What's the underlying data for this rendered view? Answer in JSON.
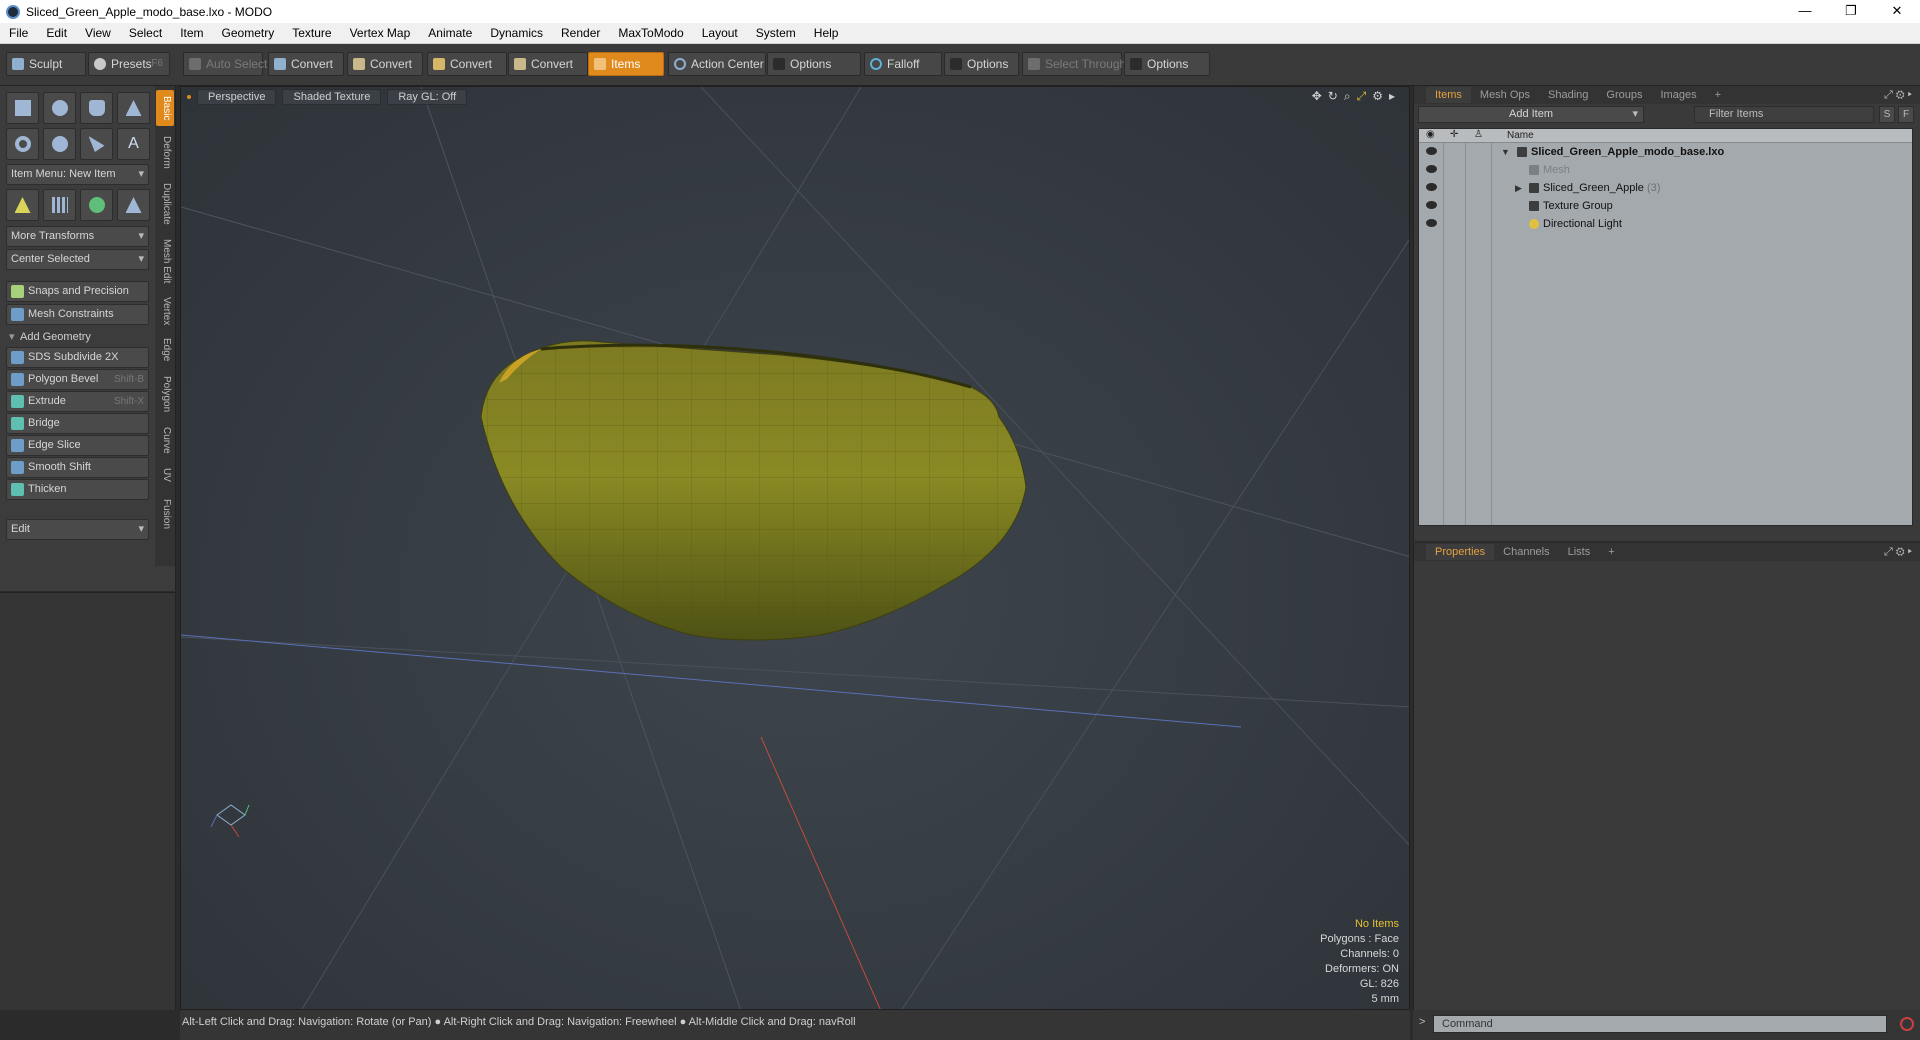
{
  "window": {
    "title": "Sliced_Green_Apple_modo_base.lxo - MODO",
    "controls": [
      "—",
      "❐",
      "✕"
    ]
  },
  "menubar": [
    "File",
    "Edit",
    "View",
    "Select",
    "Item",
    "Geometry",
    "Texture",
    "Vertex Map",
    "Animate",
    "Dynamics",
    "Render",
    "MaxToModo",
    "Layout",
    "System",
    "Help"
  ],
  "toolbar": {
    "sculpt": "Sculpt",
    "presets": "Presets",
    "presets_hotkey": "F6",
    "auto_select": "Auto Select",
    "convert1": "Convert",
    "convert2": "Convert",
    "convert3": "Convert",
    "convert4": "Convert",
    "items": "Items",
    "action_center": "Action Center",
    "options1": "Options",
    "falloff": "Falloff",
    "options2": "Options",
    "select_through": "Select Through",
    "options3": "Options"
  },
  "left_tabs": [
    "Basic",
    "Deform",
    "Duplicate",
    "Mesh Edit",
    "Vertex",
    "Edge",
    "Polygon",
    "Curve",
    "UV",
    "Fusion"
  ],
  "left_panel": {
    "item_menu": "Item Menu: New Item",
    "more_transforms": "More Transforms",
    "center_selected": "Center Selected",
    "snaps": "Snaps and Precision",
    "mesh_constraints": "Mesh Constraints",
    "add_geometry": "Add Geometry",
    "tools": [
      {
        "label": "SDS Subdivide 2X",
        "hotkey": ""
      },
      {
        "label": "Polygon Bevel",
        "hotkey": "Shift-B"
      },
      {
        "label": "Extrude",
        "hotkey": "Shift-X"
      },
      {
        "label": "Bridge",
        "hotkey": ""
      },
      {
        "label": "Edge Slice",
        "hotkey": ""
      },
      {
        "label": "Smooth Shift",
        "hotkey": ""
      },
      {
        "label": "Thicken",
        "hotkey": ""
      }
    ],
    "edit_dropdown": "Edit"
  },
  "viewport": {
    "tabs": [
      "Perspective",
      "Shaded Texture",
      "Ray GL: Off"
    ],
    "stats": {
      "items": "No Items",
      "polygons": "Polygons : Face",
      "channels": "Channels: 0",
      "deformers": "Deformers: ON",
      "gl": "GL: 826",
      "scale": "5 mm"
    },
    "status": "Alt-Left Click and Drag: Navigation: Rotate (or Pan) ● Alt-Right Click and Drag: Navigation: Freewheel ● Alt-Middle Click and Drag: navRoll",
    "colors": {
      "apple_light": "#8a8a24",
      "apple_dark": "#4a4d12",
      "bg": "#3a4047"
    }
  },
  "items_panel": {
    "tabs": [
      "Items",
      "Mesh Ops",
      "Shading",
      "Groups",
      "Images",
      "+"
    ],
    "add_item": "Add Item",
    "filter_placeholder": "Filter Items",
    "s_btn": "S",
    "f_btn": "F",
    "column_name": "Name",
    "tree": [
      {
        "label": "Sliced_Green_Apple_modo_base.lxo",
        "count": ""
      },
      {
        "label": "Mesh",
        "count": ""
      },
      {
        "label": "Sliced_Green_Apple",
        "count": "(3)"
      },
      {
        "label": "Texture Group",
        "count": ""
      },
      {
        "label": "Directional Light",
        "count": ""
      }
    ]
  },
  "properties_panel": {
    "tabs": [
      "Properties",
      "Channels",
      "Lists",
      "+"
    ]
  },
  "command": {
    "caret": ">",
    "placeholder": "Command"
  }
}
